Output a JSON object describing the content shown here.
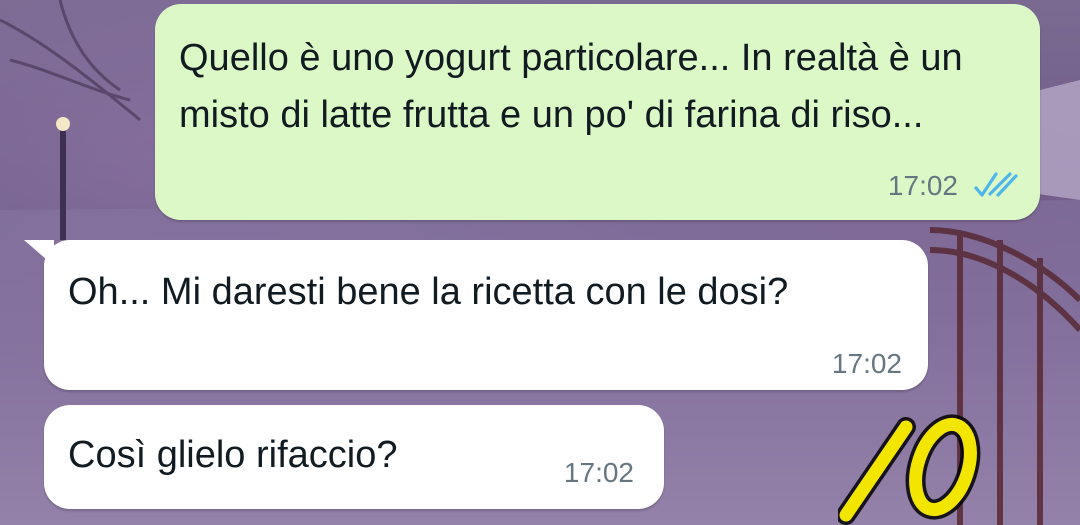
{
  "conversation": {
    "messages": [
      {
        "direction": "outgoing",
        "text": "Quello è uno yogurt particolare... In realtà è un misto di latte frutta e un po' di farina di riso...",
        "time": "17:02",
        "status_icon": "double-check-read-icon"
      },
      {
        "direction": "incoming",
        "text": "Oh... Mi daresti bene la ricetta con le dosi?",
        "time": "17:02"
      },
      {
        "direction": "incoming",
        "text": "Così glielo rifaccio?",
        "time": "17:02"
      }
    ]
  },
  "annotation": {
    "text": "10",
    "color": "#f2e600"
  },
  "colors": {
    "outgoing_bubble": "#dcf8c6",
    "incoming_bubble": "#ffffff",
    "timestamp": "#667781",
    "read_ticks": "#4fb6ec"
  }
}
